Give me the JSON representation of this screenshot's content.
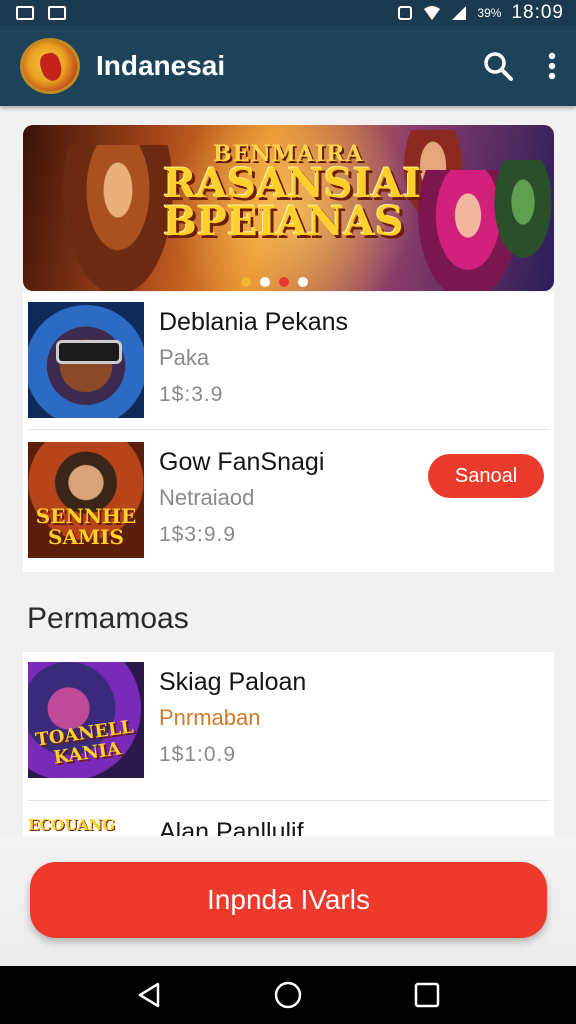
{
  "status_bar": {
    "battery": "39%",
    "time": "18:09"
  },
  "app_bar": {
    "title": "Indanesai"
  },
  "banner": {
    "small_text": "BENMAIRA",
    "big_text": "RASANSIAI BPEIANAS"
  },
  "featured": [
    {
      "title": "Deblania Pekans",
      "subtitle": "Paka",
      "price": "1$:3.9",
      "thumb_text": ""
    },
    {
      "title": "Gow FanSnagi",
      "subtitle": "Netraiaod",
      "price": "1$3:9.9",
      "badge": "Sanoal",
      "thumb_text": "SENNHE SAMIS"
    }
  ],
  "section": {
    "title": "Permamoas"
  },
  "list": [
    {
      "title": "Skiag Paloan",
      "subtitle": "Pnrmaban",
      "price": "1$1:0.9",
      "thumb_text": "TOANELL KANIA"
    },
    {
      "title": "Alan Panllulif",
      "thumb_text": "ECOUANG"
    }
  ],
  "cta": {
    "label": "Inpnda IVarls"
  },
  "colors": {
    "app_bar": "#1e4259",
    "accent": "#ee3a2d",
    "subtitle_orange": "#d2782a"
  }
}
